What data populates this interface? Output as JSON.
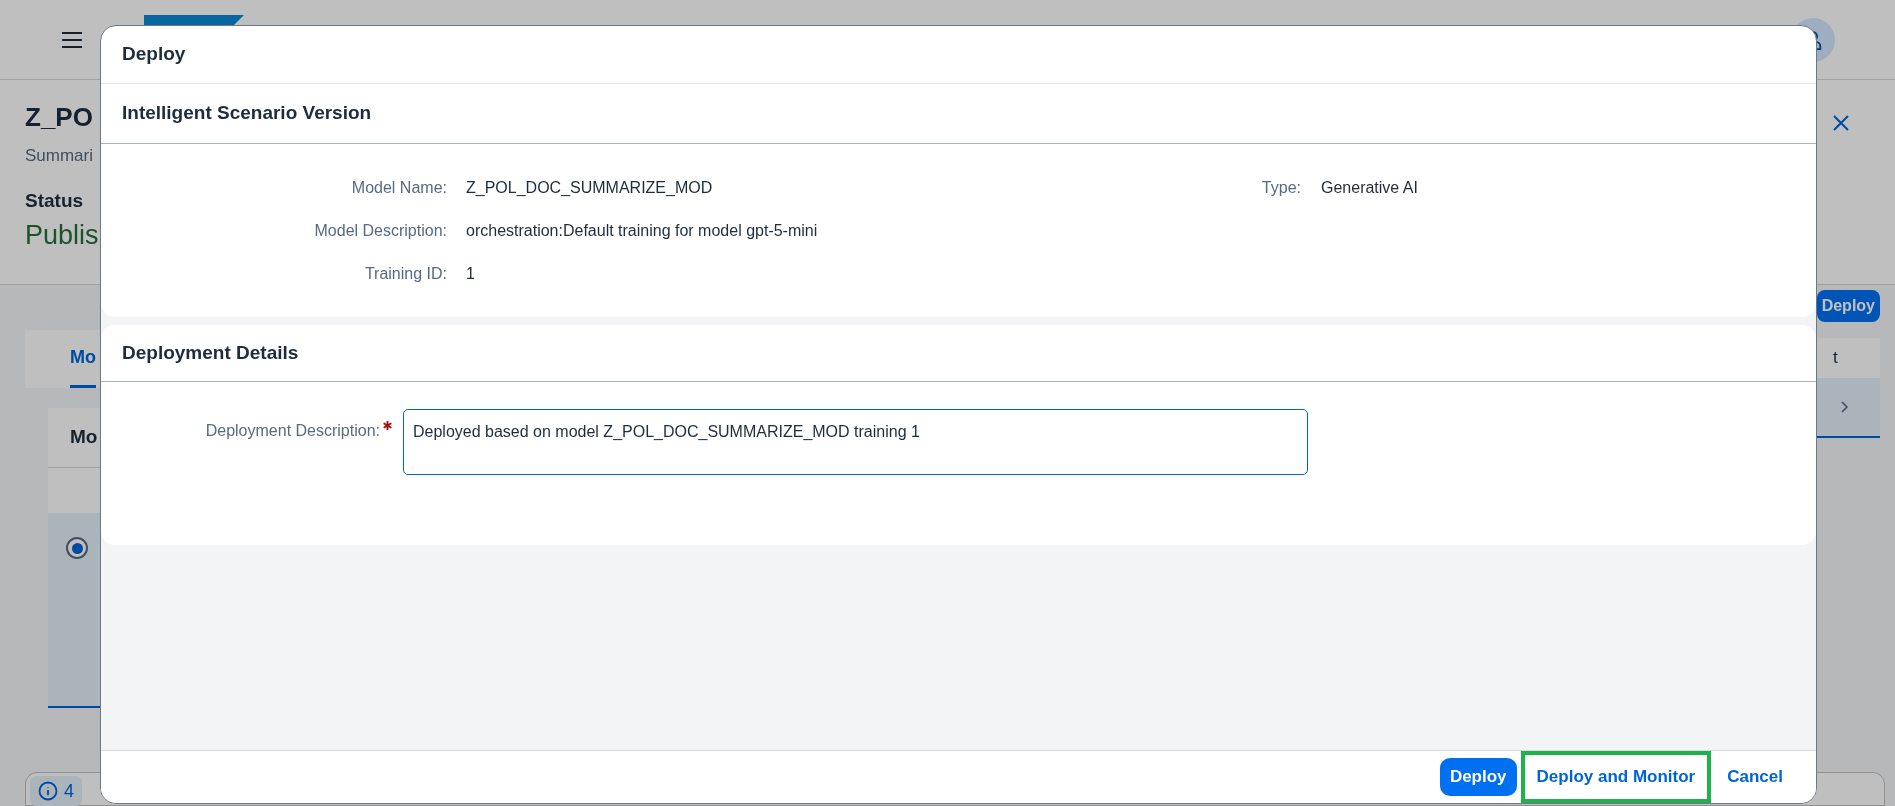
{
  "background": {
    "page_title": "Z_PO",
    "subtitle": "Summari",
    "status_label": "Status",
    "status_value": "Publis",
    "tab": {
      "label": "Mo",
      "selected": true
    },
    "table_header": "Mo",
    "row_selected": true,
    "deploy_button": "Deploy",
    "column_text": "t",
    "message_count": "4"
  },
  "dialog": {
    "title": "Deploy",
    "version_section": {
      "title": "Intelligent Scenario Version",
      "fields": [
        {
          "label": "Model Name:",
          "value": "Z_POL_DOC_SUMMARIZE_MOD"
        },
        {
          "label": "Model Description:",
          "value": "orchestration:Default training for model gpt-5-mini"
        },
        {
          "label": "Training ID:",
          "value": "1"
        }
      ],
      "side_fields": [
        {
          "label": "Type:",
          "value": "Generative AI"
        }
      ]
    },
    "details_section": {
      "title": "Deployment Details",
      "input": {
        "label": "Deployment Description:",
        "required": true,
        "value": "Deployed based on model Z_POL_DOC_SUMMARIZE_MOD training 1"
      }
    },
    "buttons": [
      {
        "label": "Deploy",
        "kind": "emphasized",
        "highlighted": false
      },
      {
        "label": "Deploy and Monitor",
        "kind": "transparent",
        "highlighted": true
      },
      {
        "label": "Cancel",
        "kind": "transparent",
        "highlighted": false
      }
    ]
  }
}
